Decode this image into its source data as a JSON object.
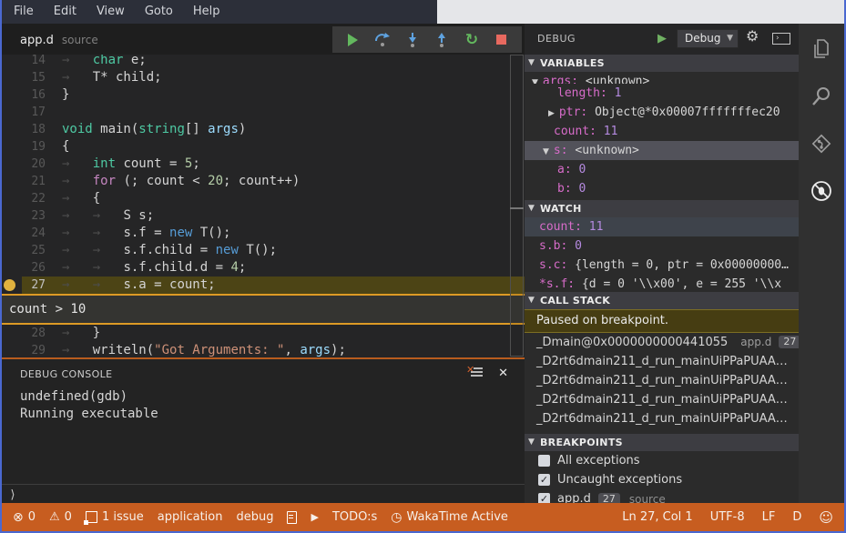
{
  "window": {
    "accent_border": "#4a68d0",
    "statusbar_color": "#c75d20",
    "breakpoint_color": "#e0b13e"
  },
  "menu_bar": {
    "items": [
      "File",
      "Edit",
      "View",
      "Goto",
      "Help"
    ]
  },
  "tab_bar": {
    "file_name": "app.d",
    "file_hint": "source"
  },
  "debug_toolbar": {
    "buttons": [
      "continue",
      "step-over",
      "step-into",
      "step-out",
      "restart",
      "stop"
    ]
  },
  "editor": {
    "current_line": "27",
    "breakpoint_line": "27",
    "widget_after": "27",
    "condition_widget": {
      "text": "count > 10"
    },
    "lines": [
      {
        "n": "14",
        "parts": [
          [
            "ws",
            "→   "
          ],
          [
            "kw",
            "char"
          ],
          [
            "pl",
            " e;"
          ]
        ]
      },
      {
        "n": "15",
        "parts": [
          [
            "ws",
            "→   "
          ],
          [
            "pl",
            "T* child;"
          ]
        ]
      },
      {
        "n": "16",
        "parts": [
          [
            "pl",
            "}"
          ]
        ]
      },
      {
        "n": "17",
        "parts": []
      },
      {
        "n": "18",
        "parts": [
          [
            "kw",
            "void"
          ],
          [
            "pl",
            " main("
          ],
          [
            "kw",
            "string"
          ],
          [
            "pl",
            "[] "
          ],
          [
            "vr",
            "args"
          ],
          [
            "pl",
            ")"
          ]
        ]
      },
      {
        "n": "19",
        "parts": [
          [
            "pl",
            "{"
          ]
        ]
      },
      {
        "n": "20",
        "parts": [
          [
            "ws",
            "→   "
          ],
          [
            "kw",
            "int"
          ],
          [
            "pl",
            " count = "
          ],
          [
            "nm",
            "5"
          ],
          [
            "pl",
            ";"
          ]
        ]
      },
      {
        "n": "21",
        "parts": [
          [
            "ws",
            "→   "
          ],
          [
            "ct",
            "for"
          ],
          [
            "pl",
            " (; count < "
          ],
          [
            "nm",
            "20"
          ],
          [
            "pl",
            "; count++)"
          ]
        ]
      },
      {
        "n": "22",
        "parts": [
          [
            "ws",
            "→   "
          ],
          [
            "pl",
            "{"
          ]
        ]
      },
      {
        "n": "23",
        "parts": [
          [
            "ws",
            "→   →   "
          ],
          [
            "pl",
            "S s;"
          ]
        ]
      },
      {
        "n": "24",
        "parts": [
          [
            "ws",
            "→   →   "
          ],
          [
            "pl",
            "s.f = "
          ],
          [
            "nw",
            "new"
          ],
          [
            "pl",
            " T();"
          ]
        ]
      },
      {
        "n": "25",
        "parts": [
          [
            "ws",
            "→   →   "
          ],
          [
            "pl",
            "s.f.child = "
          ],
          [
            "nw",
            "new"
          ],
          [
            "pl",
            " T();"
          ]
        ]
      },
      {
        "n": "26",
        "parts": [
          [
            "ws",
            "→   →   "
          ],
          [
            "pl",
            "s.f.child.d = "
          ],
          [
            "nm",
            "4"
          ],
          [
            "pl",
            ";"
          ]
        ]
      },
      {
        "n": "27",
        "parts": [
          [
            "ws",
            "→   →   "
          ],
          [
            "pl",
            "s.a = count;"
          ]
        ]
      },
      {
        "n": "28",
        "parts": [
          [
            "ws",
            "→   "
          ],
          [
            "pl",
            "}"
          ]
        ]
      },
      {
        "n": "29",
        "parts": [
          [
            "ws",
            "→   "
          ],
          [
            "pl",
            "writeln("
          ],
          [
            "st",
            "\"Got Arguments: \""
          ],
          [
            "pl",
            ", "
          ],
          [
            "vr",
            "args"
          ],
          [
            "pl",
            ");"
          ]
        ]
      }
    ]
  },
  "debug_console": {
    "title": "DEBUG CONSOLE",
    "lines": [
      "undefined(gdb)",
      "Running executable"
    ],
    "prompt": "⟩"
  },
  "debug_panel": {
    "title": "DEBUG",
    "config_name": "Debug",
    "sections": {
      "variables": {
        "title": "VARIABLES",
        "rows": [
          {
            "arrow": "open",
            "name": "args",
            "value": "<unknown>",
            "vclass": "pl",
            "pad": 8,
            "partial": true
          },
          {
            "name": "length",
            "value": "1",
            "vclass": "nm",
            "pad": 36
          },
          {
            "arrow": "closed",
            "name": "ptr",
            "value": "Object@*0x00007fffffffec20",
            "vclass": "pl",
            "pad": 26
          },
          {
            "name": "count",
            "value": "11",
            "vclass": "nm",
            "pad": 32
          },
          {
            "arrow": "open",
            "name": "s",
            "value": "<unknown>",
            "vclass": "pl",
            "pad": 20,
            "selected": true
          },
          {
            "name": "a",
            "value": "0",
            "vclass": "nm",
            "pad": 36
          },
          {
            "name": "b",
            "value": "0",
            "vclass": "nm",
            "pad": 36
          }
        ]
      },
      "watch": {
        "title": "WATCH",
        "rows": [
          {
            "name": "count",
            "value": "11",
            "vclass": "nm",
            "pad": 16,
            "wsel": true
          },
          {
            "name": "s.b",
            "value": "0",
            "vclass": "nm",
            "pad": 16
          },
          {
            "name": "s.c",
            "value": "{length = 0, ptr = 0x00000000…",
            "vclass": "pl",
            "pad": 16
          },
          {
            "name": "*s.f",
            "value": "{d = 0 '\\\\x00', e = 255 '\\\\x",
            "vclass": "pl",
            "pad": 16
          }
        ]
      },
      "call_stack": {
        "title": "CALL STACK",
        "status": "Paused on breakpoint.",
        "frames": [
          {
            "name": "_Dmain@0x0000000000441055",
            "file": "app.d",
            "line": "27"
          },
          {
            "name": "_D2rt6dmain211_d_run_mainUiPPaPUAA…"
          },
          {
            "name": "_D2rt6dmain211_d_run_mainUiPPaPUAA…"
          },
          {
            "name": "_D2rt6dmain211_d_run_mainUiPPaPUAA…"
          },
          {
            "name": "_D2rt6dmain211_d_run_mainUiPPaPUAA…"
          }
        ]
      },
      "breakpoints": {
        "title": "BREAKPOINTS",
        "rows": [
          {
            "checked": false,
            "label": "All exceptions"
          },
          {
            "checked": true,
            "label": "Uncaught exceptions"
          },
          {
            "checked": true,
            "label": "app.d",
            "badge": "27",
            "hint": "source"
          }
        ]
      }
    }
  },
  "activity_bar": {
    "items": [
      "files",
      "search",
      "git",
      "debug"
    ],
    "active": "debug"
  },
  "status_bar": {
    "left": [
      {
        "name": "errors",
        "icon": "error-icon",
        "label": "0"
      },
      {
        "name": "warnings",
        "icon": "warning-icon",
        "label": "0"
      },
      {
        "name": "issues",
        "icon": "issues-icon",
        "label": "1 issue"
      },
      {
        "name": "task-application",
        "label": "application"
      },
      {
        "name": "task-debug",
        "label": "debug"
      },
      {
        "name": "file-info",
        "icon": "document-icon",
        "label": ""
      },
      {
        "name": "run-task",
        "icon": "play-icon",
        "label": ""
      },
      {
        "name": "todos",
        "label": "TODO:s"
      },
      {
        "name": "wakatime",
        "icon": "clock-icon",
        "label": "WakaTime Active"
      }
    ],
    "right": [
      {
        "name": "cursor-position",
        "label": "Ln 27, Col 1"
      },
      {
        "name": "encoding",
        "label": "UTF-8"
      },
      {
        "name": "eol",
        "label": "LF"
      },
      {
        "name": "language-mode",
        "label": "D"
      },
      {
        "name": "feedback",
        "icon": "smiley-icon",
        "label": ""
      }
    ]
  }
}
